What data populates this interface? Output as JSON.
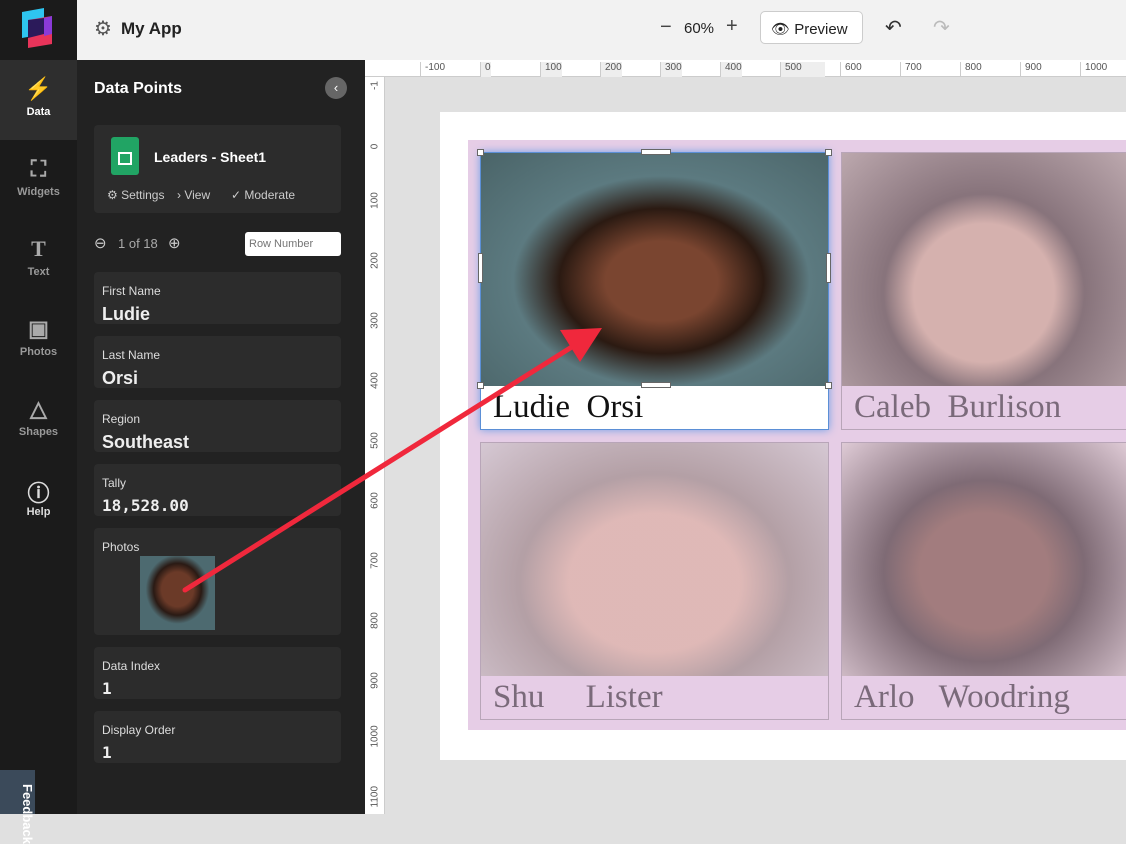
{
  "app": {
    "title": "My App",
    "zoom": "60%",
    "preview_label": "Preview"
  },
  "rail": [
    {
      "label": "Data",
      "icon": "bolt"
    },
    {
      "label": "Widgets",
      "icon": "widgets"
    },
    {
      "label": "Text",
      "icon": "T"
    },
    {
      "label": "Photos",
      "icon": "image"
    },
    {
      "label": "Shapes",
      "icon": "shapes"
    },
    {
      "label": "Help",
      "icon": "help"
    }
  ],
  "feedback": "Feedback",
  "panel": {
    "title": "Data Points",
    "source": "Leaders - Sheet1",
    "actions": [
      "Settings",
      "View",
      "Moderate"
    ],
    "pager": "1 of 18",
    "row_placeholder": "Row Number",
    "fields": [
      {
        "label": "First Name",
        "value": "Ludie"
      },
      {
        "label": "Last Name",
        "value": "Orsi"
      },
      {
        "label": "Region",
        "value": "Southeast"
      },
      {
        "label": "Tally",
        "value": "18,528.00"
      }
    ],
    "photos_label": "Photos",
    "extra": [
      {
        "label": "Data Index",
        "value": "1"
      },
      {
        "label": "Display Order",
        "value": "1"
      }
    ]
  },
  "ruler_top": [
    "-100",
    "0",
    "100",
    "200",
    "300",
    "400",
    "500",
    "600",
    "700",
    "800",
    "900",
    "1000"
  ],
  "ruler_left": [
    "-1",
    "0",
    "100",
    "200",
    "300",
    "400",
    "500",
    "600",
    "700",
    "800",
    "900",
    "1000",
    "1100"
  ],
  "cards": [
    {
      "first": "Ludie",
      "last": "Orsi"
    },
    {
      "first": "Caleb",
      "last": "Burlison"
    },
    {
      "first": "Shu",
      "last": "Lister"
    },
    {
      "first": "Arlo",
      "last": "Woodring"
    }
  ],
  "colors": {
    "accent": "#f5c32c",
    "arrow": "#f0283c",
    "grid": "#e6cde6"
  }
}
